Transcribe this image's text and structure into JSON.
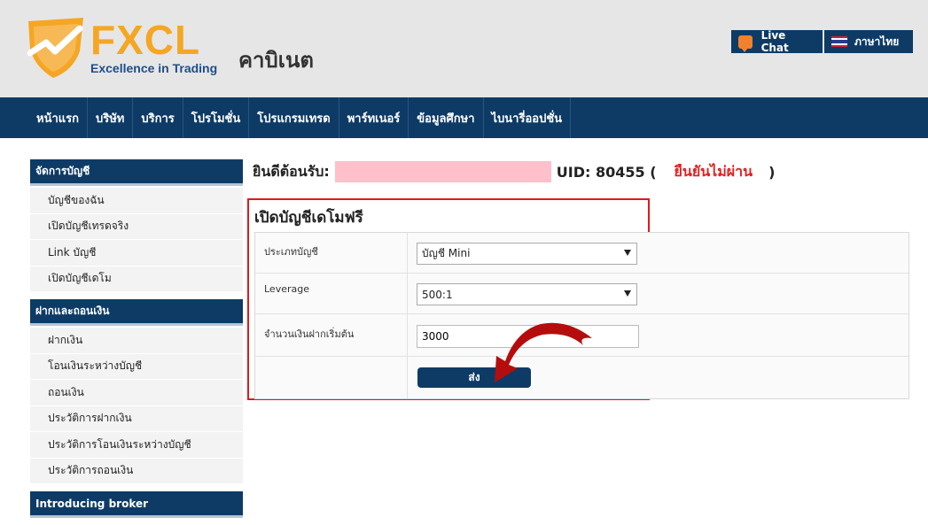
{
  "header": {
    "logo_text": "FXCL",
    "logo_tagline": "Excellence in Trading",
    "page_title": "คาบิเนต",
    "live_chat_label": "Live Chat",
    "language_label": "ภาษาไทย"
  },
  "nav": {
    "items": [
      "หน้าแรก",
      "บริษัท",
      "บริการ",
      "โปรโมชั่น",
      "โปรแกรมเทรด",
      "พาร์ทเนอร์",
      "ข้อมูลศึกษา",
      "ไบนารี่ออปชั่น"
    ]
  },
  "sidebar": {
    "sections": [
      {
        "title": "จัดการบัญชี",
        "items": [
          "บัญชีของฉัน",
          "เปิดบัญชีเทรดจริง",
          "Link บัญชี",
          "เปิดบัญชีเดโม"
        ]
      },
      {
        "title": "ฝากและถอนเงิน",
        "items": [
          "ฝากเงิน",
          "โอนเงินระหว่างบัญชี",
          "ถอนเงิน",
          "ประวัติการฝากเงิน",
          "ประวัติการโอนเงินระหว่างบัญชี",
          "ประวัติการถอนเงิน"
        ]
      },
      {
        "title": "Introducing broker",
        "items": []
      }
    ]
  },
  "welcome": {
    "prefix": "ยินดีต้อนรับ:",
    "uid_label": "UID: 80455 (",
    "status": "ยืนยันไม่ผ่าน",
    "suffix": ")"
  },
  "form": {
    "title": "เปิดบัญชีเดโมฟรี",
    "account_type_label": "ประเภทบัญชี",
    "account_type_value": "บัญชี Mini",
    "leverage_label": "Leverage",
    "leverage_value": "500:1",
    "deposit_label": "จำนวนเงินฝากเริ่มต้น",
    "deposit_value": "3000",
    "submit_label": "ส่ง"
  },
  "colors": {
    "nav_bg": "#0d3b66",
    "header_bg": "#e6e6e6",
    "accent": "#f5a623",
    "status_red": "#e02020",
    "highlight_border": "#e01a1a"
  },
  "icons": {
    "live_chat": "chat-bubble-icon",
    "language": "thai-flag-icon",
    "annotation": "curved-arrow-icon"
  }
}
